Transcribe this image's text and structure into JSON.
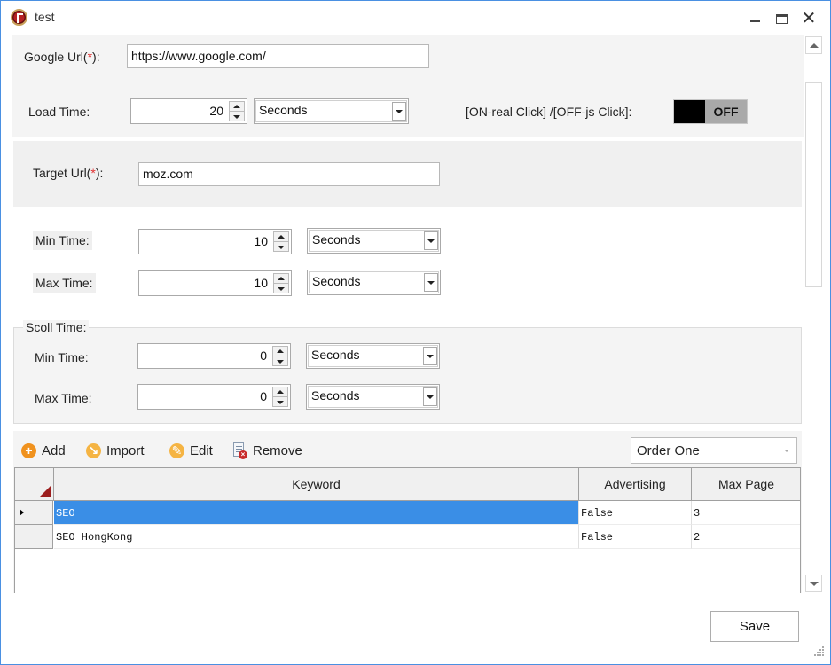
{
  "window": {
    "title": "test",
    "icon": "app-logo-icon",
    "controls": {
      "minimize": "minimize-icon",
      "maximize": "maximize-icon",
      "close": "close-icon",
      "close_glyph": "✕"
    }
  },
  "google": {
    "label_prefix": "Google Url(",
    "required_mark": "*",
    "label_suffix": "):",
    "value": "https://www.google.com/"
  },
  "load_time": {
    "label": "Load Time:",
    "value": "20",
    "unit": "Seconds"
  },
  "click_mode": {
    "label": "[ON-real Click] /[OFF-js Click]:",
    "state": "OFF"
  },
  "target": {
    "label_prefix": "Target Url(",
    "required_mark": "*",
    "label_suffix": "):",
    "value": "moz.com"
  },
  "stay_time": {
    "min": {
      "label": "Min Time:",
      "value": "10",
      "unit": "Seconds"
    },
    "max": {
      "label": "Max Time:",
      "value": "10",
      "unit": "Seconds"
    }
  },
  "scroll_time": {
    "legend": "Scoll Time:",
    "min": {
      "label": "Min Time:",
      "value": "0",
      "unit": "Seconds"
    },
    "max": {
      "label": "Max Time:",
      "value": "0",
      "unit": "Seconds"
    }
  },
  "toolbar": {
    "add": "Add",
    "import": "Import",
    "edit": "Edit",
    "remove": "Remove",
    "order_select": "Order One"
  },
  "grid": {
    "columns": [
      "Keyword",
      "Advertising",
      "Max Page"
    ],
    "rows": [
      {
        "keyword": "SEO",
        "advertising": "False",
        "max_page": "3",
        "selected": true
      },
      {
        "keyword": "SEO HongKong",
        "advertising": "False",
        "max_page": "2",
        "selected": false
      }
    ]
  },
  "actions": {
    "save": "Save"
  },
  "colors": {
    "selection": "#3a8ee6",
    "required": "#e23030",
    "accent_orange": "#f0921e",
    "window_border": "#4a90e2"
  }
}
